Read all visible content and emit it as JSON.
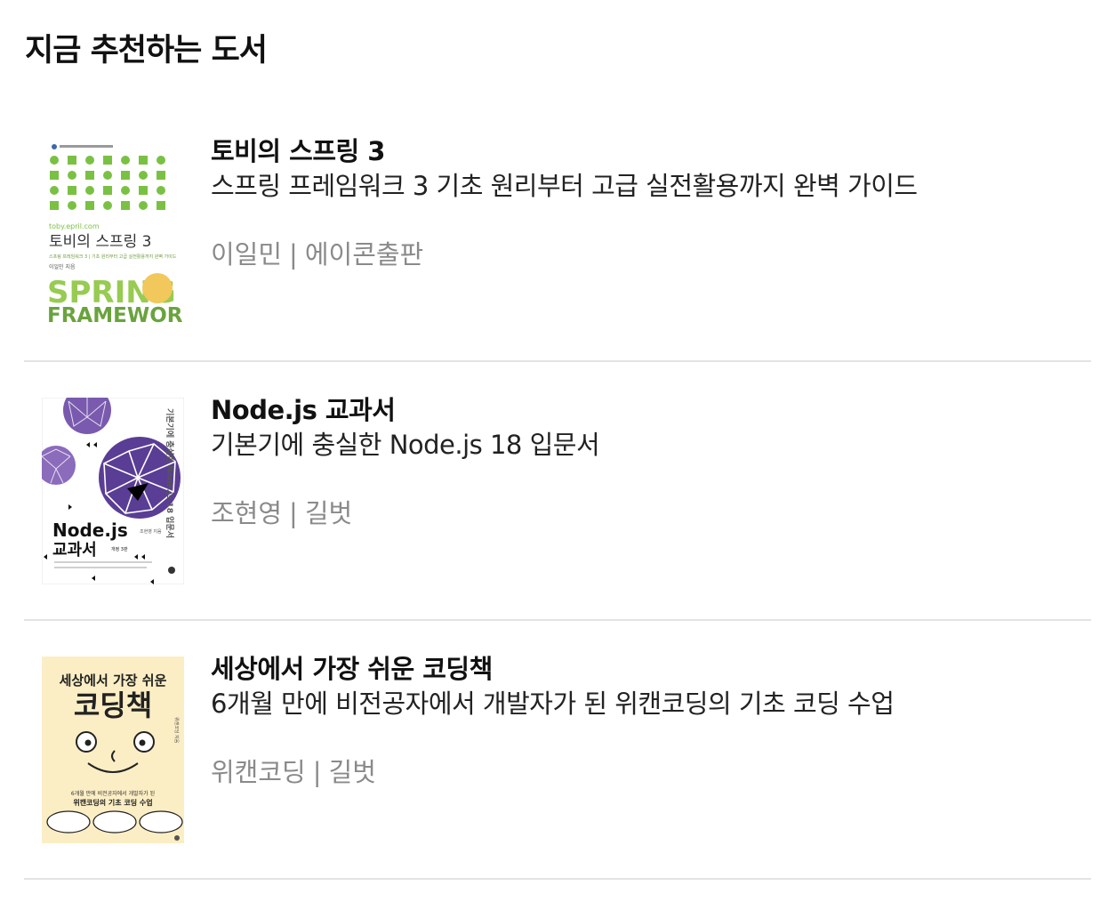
{
  "section": {
    "title": "지금 추천하는 도서"
  },
  "books": [
    {
      "title": "토비의 스프링 3",
      "subtitle": "스프링 프레임워크 3 기초 원리부터 고급 실전활용까지 완벽 가이드",
      "author": "이일민",
      "separator": "|",
      "publisher": "에이콘출판",
      "cover": {
        "title": "토비의 스프링 3",
        "url": "toby.epril.com",
        "tagline": "스프링 프레임워크 3 | 기초 원리부터 고급 실전활용까지 완벽 가이드",
        "author": "이일민 지음",
        "logo_line1": "SPRING",
        "logo_line2": "FRAMEWORK",
        "accent": "#7ac143"
      }
    },
    {
      "title": "Node.js 교과서",
      "subtitle": "기본기에 충실한 Node.js 18 입문서",
      "author": "조현영",
      "separator": "|",
      "publisher": "길벗",
      "cover": {
        "title_line1": "Node.js",
        "title_line2": "교과서",
        "edition": "개정 3판",
        "vertical": "기본기에 충실한 Node.js 18 입문서",
        "author": "조현영 지음",
        "accent": "#6b4ca0"
      }
    },
    {
      "title": "세상에서 가장 쉬운 코딩책",
      "subtitle": "6개월 만에 비전공자에서 개발자가 된 위캔코딩의 기초 코딩 수업",
      "author": "위캔코딩",
      "separator": "|",
      "publisher": "길벗",
      "cover": {
        "title_small": "세상에서 가장 쉬운",
        "title_big": "코딩책",
        "desc1": "6개월 만에 비전공자에서 개발자가 된",
        "desc2": "위캔코딩의 기초 코딩 수업",
        "author": "위캔코딩 지음",
        "background": "#fbeec4"
      }
    }
  ]
}
